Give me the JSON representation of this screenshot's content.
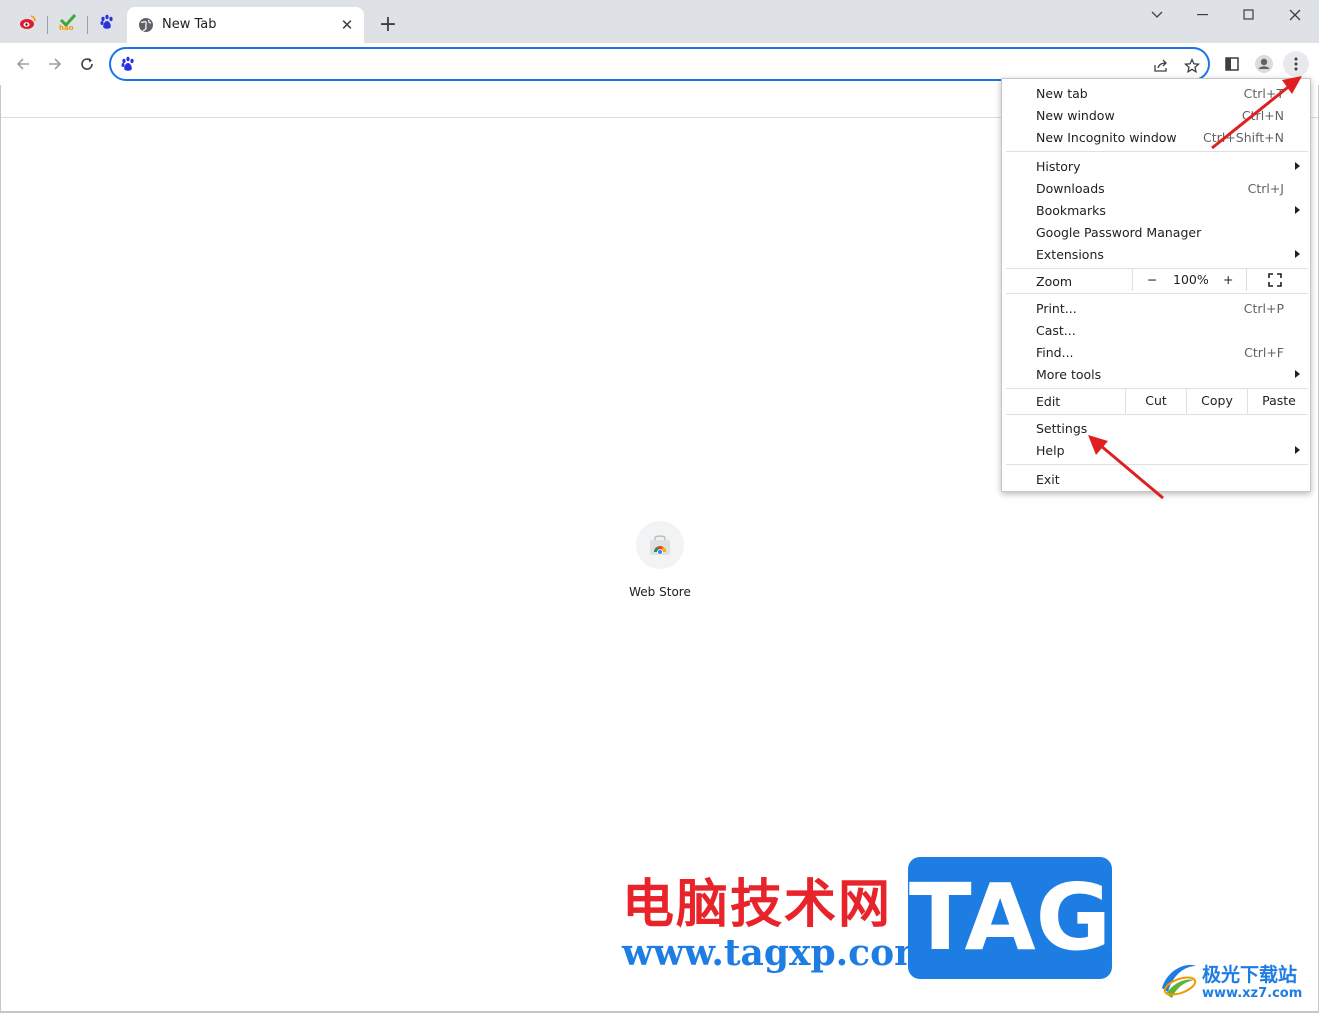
{
  "tabs": {
    "active_title": "New Tab",
    "pinned": [
      "weibo-icon",
      "hao123-icon",
      "baidu-icon"
    ]
  },
  "omnibox": {
    "value": "",
    "placeholder": ""
  },
  "shortcut": {
    "label": "Web Store"
  },
  "menu": {
    "group1": [
      {
        "label": "New tab",
        "shortcut": "Ctrl+T"
      },
      {
        "label": "New window",
        "shortcut": "Ctrl+N"
      },
      {
        "label": "New Incognito window",
        "shortcut": "Ctrl+Shift+N"
      }
    ],
    "group2": [
      {
        "label": "History",
        "shortcut": ""
      },
      {
        "label": "Downloads",
        "shortcut": "Ctrl+J"
      },
      {
        "label": "Bookmarks",
        "shortcut": ""
      },
      {
        "label": "Google Password Manager",
        "shortcut": ""
      },
      {
        "label": "Extensions",
        "shortcut": ""
      }
    ],
    "zoom": {
      "label": "Zoom",
      "minus": "−",
      "value": "100%",
      "plus": "+"
    },
    "group3": [
      {
        "label": "Print...",
        "shortcut": "Ctrl+P"
      },
      {
        "label": "Cast...",
        "shortcut": ""
      },
      {
        "label": "Find...",
        "shortcut": "Ctrl+F"
      },
      {
        "label": "More tools",
        "shortcut": ""
      }
    ],
    "edit": {
      "label": "Edit",
      "cut": "Cut",
      "copy": "Copy",
      "paste": "Paste"
    },
    "group4": [
      {
        "label": "Settings"
      },
      {
        "label": "Help"
      }
    ],
    "exit": "Exit"
  },
  "watermark": {
    "cn_title": "电脑技术网",
    "url": "www.tagxp.com",
    "tag": "TAG",
    "xz_cn": "极光下载站",
    "xz_url": "www.xz7.com"
  },
  "colors": {
    "accent": "#1a73e8",
    "annotation_arrow": "#e02020",
    "watermark_red": "#e8242a",
    "watermark_blue": "#1d7de3"
  }
}
